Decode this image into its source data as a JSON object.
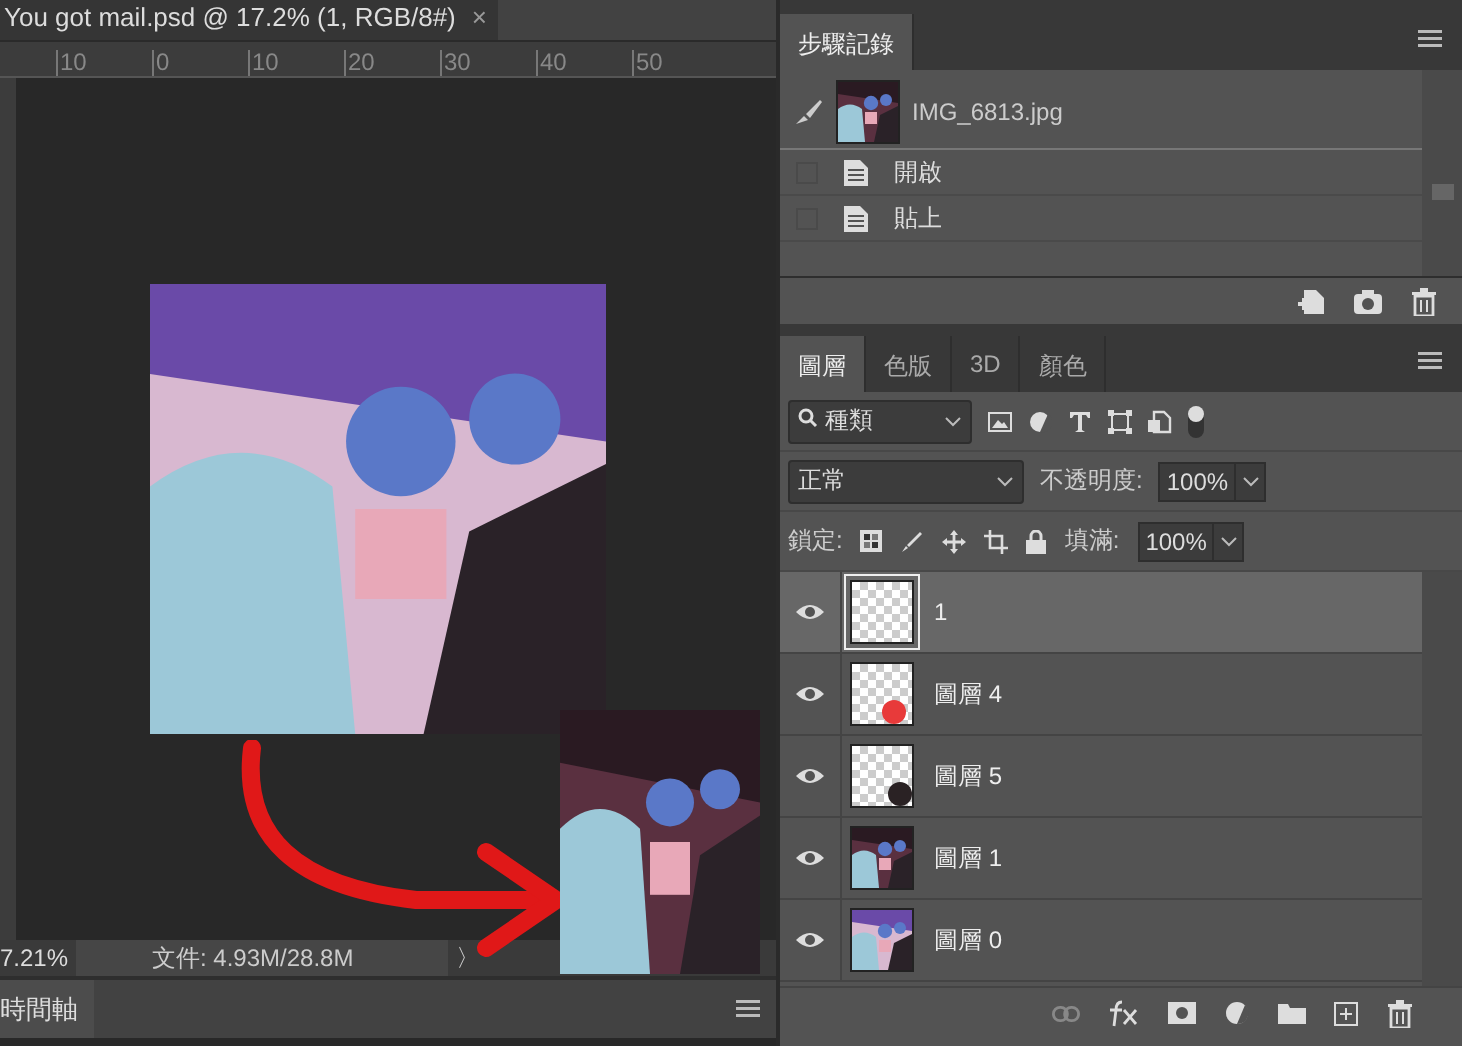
{
  "document_tab": {
    "title": "You got mail.psd @ 17.2% (1, RGB/8#)",
    "close": "×"
  },
  "ruler": [
    "10",
    "0",
    "10",
    "20",
    "30",
    "40",
    "50"
  ],
  "status_bar": {
    "zoom": "7.21%",
    "doc_size": "文件: 4.93M/28.8M",
    "arrow": "〉"
  },
  "timeline": {
    "title": "時間軸"
  },
  "history": {
    "tab": "步驟記錄",
    "snapshot": "IMG_6813.jpg",
    "items": [
      {
        "label": "開啟",
        "checked": false
      },
      {
        "label": "貼上",
        "checked": false
      }
    ]
  },
  "layers_panel": {
    "tabs": [
      {
        "label": "圖層",
        "selected": true
      },
      {
        "label": "色版",
        "selected": false
      },
      {
        "label": "3D",
        "selected": false
      },
      {
        "label": "顏色",
        "selected": false
      }
    ],
    "filter": "種類",
    "blend_mode": "正常",
    "opacity_label": "不透明度:",
    "opacity": "100%",
    "lock_label": "鎖定:",
    "fill_label": "填滿:",
    "fill": "100%",
    "layers": [
      {
        "name": "1",
        "kind": "empty",
        "visible": true,
        "selected": true
      },
      {
        "name": "圖層 4",
        "kind": "red-dot",
        "visible": true,
        "selected": false
      },
      {
        "name": "圖層 5",
        "kind": "dark-dot",
        "visible": true,
        "selected": false
      },
      {
        "name": "圖層 1",
        "kind": "picture",
        "visible": true,
        "selected": false
      },
      {
        "name": "圖層 0",
        "kind": "picture",
        "visible": true,
        "selected": false
      }
    ]
  }
}
